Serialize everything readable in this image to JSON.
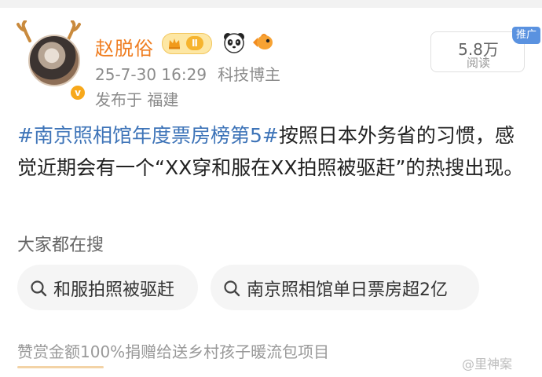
{
  "author": {
    "name": "赵脱俗",
    "vip_level": "Ⅱ",
    "avatar_badge": "v"
  },
  "post_meta": {
    "datetime": "25-7-30 16:29",
    "role": "科技博主",
    "location": "发布于 福建"
  },
  "stats": {
    "reads_count": "5.8万",
    "reads_label": "阅读",
    "ad_tag": "推广"
  },
  "content": {
    "hashtag": "#南京照相馆年度票房榜第5#",
    "text": "按照日本外务省的习惯，感觉近期会有一个“XX穿和服在XX拍照被驱赶”的热搜出现。"
  },
  "search": {
    "title": "大家都在搜",
    "chips": [
      {
        "label": "和服拍照被驱赶"
      },
      {
        "label": "南京照相馆单日票房超2亿"
      }
    ]
  },
  "donation": "赞赏金额100%捐赠给送乡村孩子暖流包项目",
  "watermark": "@里神案",
  "colors": {
    "username": "#ef7d20",
    "hashtag": "#3e74b8",
    "ad_tag": "#5a92e0",
    "vip_badge": "#fde7a4",
    "meta_text": "#8c8c8c"
  },
  "icons": [
    "antler-icon",
    "avatar-verified-icon",
    "crown-icon",
    "panda-icon",
    "fish-icon",
    "search-icon"
  ]
}
